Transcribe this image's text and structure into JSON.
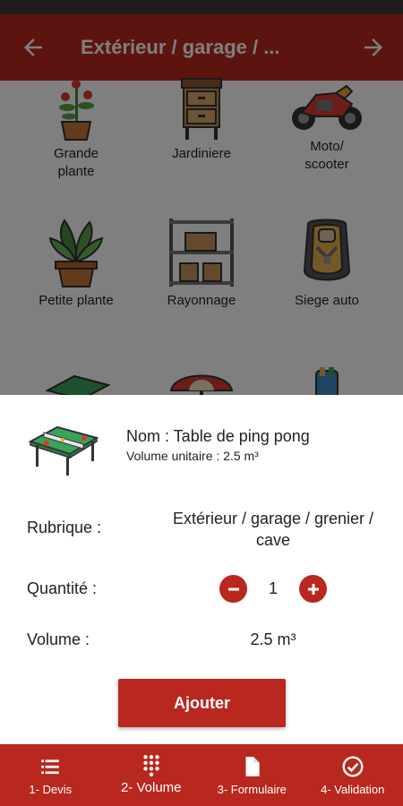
{
  "app_bar": {
    "title": "Extérieur / garage / ...",
    "back_icon": "arrow-left-icon",
    "forward_icon": "arrow-right-icon"
  },
  "catalog": {
    "items": [
      {
        "label": "Grande plante",
        "icon": "large-plant-icon"
      },
      {
        "label": "Jardiniere",
        "icon": "planter-cabinet-icon"
      },
      {
        "label": "Moto/ scooter",
        "icon": "motorcycle-icon"
      },
      {
        "label": "Petite plante",
        "icon": "small-plant-icon"
      },
      {
        "label": "Rayonnage",
        "icon": "shelving-icon"
      },
      {
        "label": "Siege auto",
        "icon": "car-seat-icon"
      }
    ]
  },
  "sheet": {
    "item_icon": "ping-pong-table-icon",
    "name": "Nom : Table de ping pong",
    "unit_volume": "Volume unitaire : 2.5 m³",
    "rubrique_label": "Rubrique :",
    "rubrique_value": "Extérieur / garage / grenier / cave",
    "quantity_label": "Quantité :",
    "quantity_value": "1",
    "volume_label": "Volume :",
    "volume_value": "2.5 m³",
    "add_button": "Ajouter"
  },
  "bottom_nav": {
    "items": [
      {
        "label": "1- Devis",
        "icon": "list-icon"
      },
      {
        "label": "2- Volume",
        "icon": "keypad-icon",
        "active": true
      },
      {
        "label": "3- Formulaire",
        "icon": "document-icon"
      },
      {
        "label": "4- Validation",
        "icon": "check-circle-icon"
      }
    ]
  },
  "colors": {
    "primary": "#b8281e",
    "scrim": "rgba(0,0,0,0.5)",
    "background": "#ffffff"
  }
}
